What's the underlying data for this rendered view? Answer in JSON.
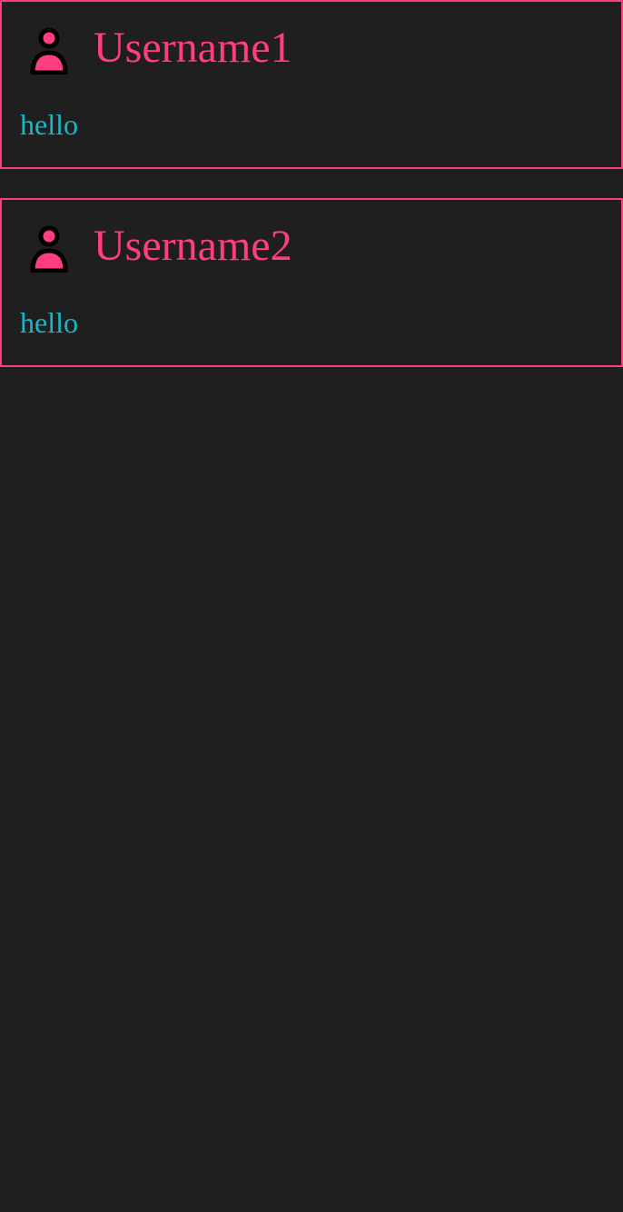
{
  "posts": [
    {
      "username": "Username1",
      "message": "hello",
      "avatar_icon": "user-icon"
    },
    {
      "username": "Username2",
      "message": "hello",
      "avatar_icon": "user-icon"
    }
  ],
  "colors": {
    "background": "#1f1f1f",
    "accent": "#ff3d7f",
    "message_text": "#19b7c7",
    "icon_outline": "#000000"
  }
}
